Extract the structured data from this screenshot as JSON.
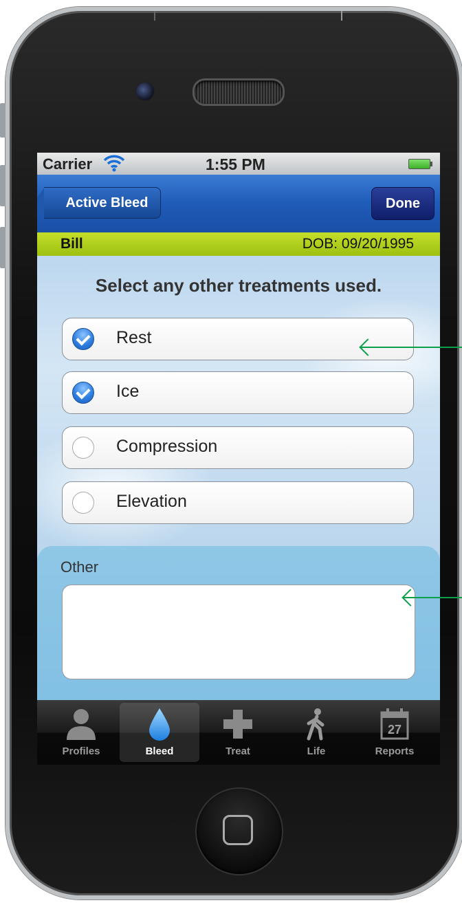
{
  "status_bar": {
    "carrier": "Carrier",
    "time": "1:55 PM"
  },
  "nav_bar": {
    "back_label": "Active Bleed",
    "done_label": "Done"
  },
  "patient": {
    "name": "Bill",
    "dob": "DOB: 09/20/1995"
  },
  "prompt": "Select any other treatments used.",
  "options": [
    {
      "label": "Rest",
      "checked": true
    },
    {
      "label": "Ice",
      "checked": true
    },
    {
      "label": "Compression",
      "checked": false
    },
    {
      "label": "Elevation",
      "checked": false
    }
  ],
  "other": {
    "label": "Other",
    "value": ""
  },
  "tabs": [
    {
      "label": "Profiles",
      "icon": "person-icon",
      "active": false
    },
    {
      "label": "Bleed",
      "icon": "drop-icon",
      "active": true
    },
    {
      "label": "Treat",
      "icon": "cross-icon",
      "active": false
    },
    {
      "label": "Life",
      "icon": "walking-person-icon",
      "active": false
    },
    {
      "label": "Reports",
      "icon": "calendar-icon",
      "active": false,
      "badge": "27"
    }
  ],
  "colors": {
    "nav_blue": "#1f5bb8",
    "patient_bar_green": "#b0d01c",
    "check_blue": "#2f7fe0",
    "annotation_arrow": "#0aa04a"
  }
}
